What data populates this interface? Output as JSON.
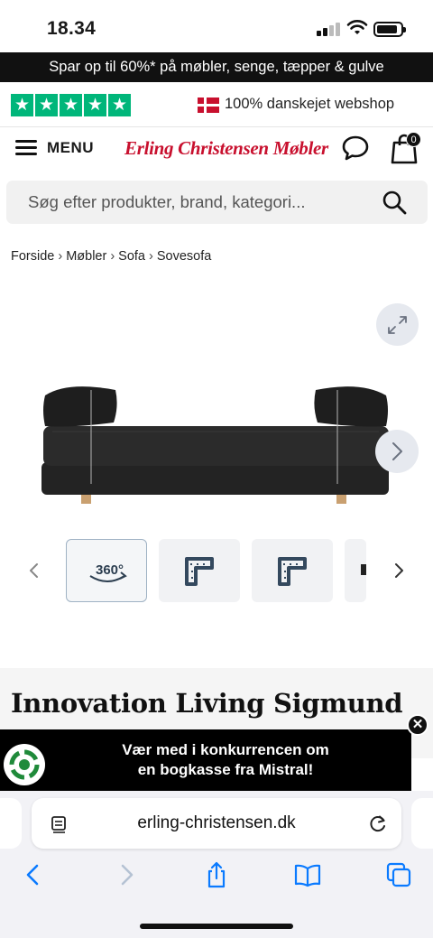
{
  "status_bar": {
    "time": "18.34"
  },
  "promo": {
    "text": "Spar op til 60%* på møbler, senge, tæpper & gulve"
  },
  "trust": {
    "text": "100% danskejet webshop",
    "star_count": 5,
    "star_color": "#00b67a"
  },
  "header": {
    "menu_label": "MENU",
    "logo": "Erling Christensen Møbler",
    "cart_count": "0",
    "logo_color": "#c8102e"
  },
  "search": {
    "placeholder": "Søg efter produkter, brand, kategori..."
  },
  "breadcrumb": {
    "items": [
      "Forside",
      "Møbler",
      "Sofa",
      "Sovesofa"
    ]
  },
  "gallery": {
    "thumb_360_label": "360°"
  },
  "product": {
    "title": "Innovation Living Sigmund"
  },
  "contest": {
    "line1": "Vær med i konkurrencen om",
    "line2": "en bogkasse fra Mistral!"
  },
  "browser": {
    "url": "erling-christensen.dk"
  }
}
